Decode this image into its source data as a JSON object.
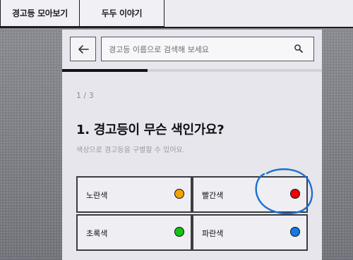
{
  "tabs": [
    {
      "label": "경고등 모아보기"
    },
    {
      "label": "두두 이야기"
    }
  ],
  "search": {
    "placeholder": "경고등 이름으로 검색해 보세요",
    "value": ""
  },
  "progress": {
    "fraction": 0.33
  },
  "quiz": {
    "step": "1 / 3",
    "question": "1. 경고등이 무슨 색인가요?",
    "hint": "색상으로 경고등을 구별할 수 있어요.",
    "options": [
      {
        "label": "노란색",
        "color": "#f5a300"
      },
      {
        "label": "빨간색",
        "color": "#f00000"
      },
      {
        "label": "초록색",
        "color": "#11c411"
      },
      {
        "label": "파란색",
        "color": "#1479e8"
      }
    ]
  },
  "icons": {
    "back": "arrow-left-icon",
    "search": "search-icon"
  },
  "annotation": {
    "color": "#1a6fd1"
  }
}
